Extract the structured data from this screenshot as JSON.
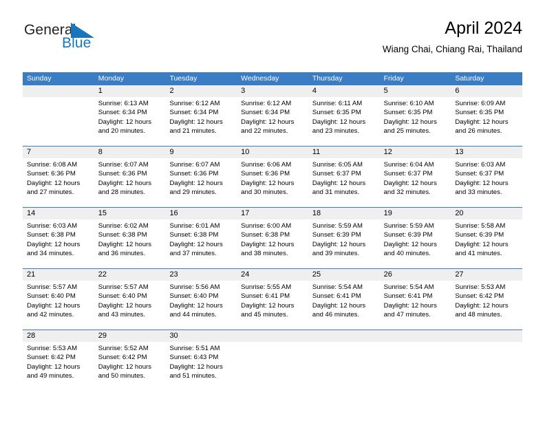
{
  "brand": {
    "name_part1": "General",
    "name_part2": "Blue",
    "flag_icon": "blue-triangle-flag-icon",
    "color_dark": "#231f20",
    "color_blue": "#1b75bc"
  },
  "header": {
    "title": "April 2024",
    "subtitle": "Wiang Chai, Chiang Rai, Thailand"
  },
  "theme": {
    "header_bg": "#3b7dc4",
    "header_text": "#ffffff",
    "daynum_bg": "#efefef",
    "rule_color": "#3b7dc4",
    "page_bg": "#ffffff"
  },
  "weekdays": [
    "Sunday",
    "Monday",
    "Tuesday",
    "Wednesday",
    "Thursday",
    "Friday",
    "Saturday"
  ],
  "weeks": [
    {
      "days": [
        {
          "num": "",
          "sunrise": "",
          "sunset": "",
          "daylight": "",
          "empty": true
        },
        {
          "num": "1",
          "sunrise": "Sunrise: 6:13 AM",
          "sunset": "Sunset: 6:34 PM",
          "daylight": "Daylight: 12 hours and 20 minutes."
        },
        {
          "num": "2",
          "sunrise": "Sunrise: 6:12 AM",
          "sunset": "Sunset: 6:34 PM",
          "daylight": "Daylight: 12 hours and 21 minutes."
        },
        {
          "num": "3",
          "sunrise": "Sunrise: 6:12 AM",
          "sunset": "Sunset: 6:34 PM",
          "daylight": "Daylight: 12 hours and 22 minutes."
        },
        {
          "num": "4",
          "sunrise": "Sunrise: 6:11 AM",
          "sunset": "Sunset: 6:35 PM",
          "daylight": "Daylight: 12 hours and 23 minutes."
        },
        {
          "num": "5",
          "sunrise": "Sunrise: 6:10 AM",
          "sunset": "Sunset: 6:35 PM",
          "daylight": "Daylight: 12 hours and 25 minutes."
        },
        {
          "num": "6",
          "sunrise": "Sunrise: 6:09 AM",
          "sunset": "Sunset: 6:35 PM",
          "daylight": "Daylight: 12 hours and 26 minutes."
        }
      ]
    },
    {
      "days": [
        {
          "num": "7",
          "sunrise": "Sunrise: 6:08 AM",
          "sunset": "Sunset: 6:36 PM",
          "daylight": "Daylight: 12 hours and 27 minutes."
        },
        {
          "num": "8",
          "sunrise": "Sunrise: 6:07 AM",
          "sunset": "Sunset: 6:36 PM",
          "daylight": "Daylight: 12 hours and 28 minutes."
        },
        {
          "num": "9",
          "sunrise": "Sunrise: 6:07 AM",
          "sunset": "Sunset: 6:36 PM",
          "daylight": "Daylight: 12 hours and 29 minutes."
        },
        {
          "num": "10",
          "sunrise": "Sunrise: 6:06 AM",
          "sunset": "Sunset: 6:36 PM",
          "daylight": "Daylight: 12 hours and 30 minutes."
        },
        {
          "num": "11",
          "sunrise": "Sunrise: 6:05 AM",
          "sunset": "Sunset: 6:37 PM",
          "daylight": "Daylight: 12 hours and 31 minutes."
        },
        {
          "num": "12",
          "sunrise": "Sunrise: 6:04 AM",
          "sunset": "Sunset: 6:37 PM",
          "daylight": "Daylight: 12 hours and 32 minutes."
        },
        {
          "num": "13",
          "sunrise": "Sunrise: 6:03 AM",
          "sunset": "Sunset: 6:37 PM",
          "daylight": "Daylight: 12 hours and 33 minutes."
        }
      ]
    },
    {
      "days": [
        {
          "num": "14",
          "sunrise": "Sunrise: 6:03 AM",
          "sunset": "Sunset: 6:38 PM",
          "daylight": "Daylight: 12 hours and 34 minutes."
        },
        {
          "num": "15",
          "sunrise": "Sunrise: 6:02 AM",
          "sunset": "Sunset: 6:38 PM",
          "daylight": "Daylight: 12 hours and 36 minutes."
        },
        {
          "num": "16",
          "sunrise": "Sunrise: 6:01 AM",
          "sunset": "Sunset: 6:38 PM",
          "daylight": "Daylight: 12 hours and 37 minutes."
        },
        {
          "num": "17",
          "sunrise": "Sunrise: 6:00 AM",
          "sunset": "Sunset: 6:38 PM",
          "daylight": "Daylight: 12 hours and 38 minutes."
        },
        {
          "num": "18",
          "sunrise": "Sunrise: 5:59 AM",
          "sunset": "Sunset: 6:39 PM",
          "daylight": "Daylight: 12 hours and 39 minutes."
        },
        {
          "num": "19",
          "sunrise": "Sunrise: 5:59 AM",
          "sunset": "Sunset: 6:39 PM",
          "daylight": "Daylight: 12 hours and 40 minutes."
        },
        {
          "num": "20",
          "sunrise": "Sunrise: 5:58 AM",
          "sunset": "Sunset: 6:39 PM",
          "daylight": "Daylight: 12 hours and 41 minutes."
        }
      ]
    },
    {
      "days": [
        {
          "num": "21",
          "sunrise": "Sunrise: 5:57 AM",
          "sunset": "Sunset: 6:40 PM",
          "daylight": "Daylight: 12 hours and 42 minutes."
        },
        {
          "num": "22",
          "sunrise": "Sunrise: 5:57 AM",
          "sunset": "Sunset: 6:40 PM",
          "daylight": "Daylight: 12 hours and 43 minutes."
        },
        {
          "num": "23",
          "sunrise": "Sunrise: 5:56 AM",
          "sunset": "Sunset: 6:40 PM",
          "daylight": "Daylight: 12 hours and 44 minutes."
        },
        {
          "num": "24",
          "sunrise": "Sunrise: 5:55 AM",
          "sunset": "Sunset: 6:41 PM",
          "daylight": "Daylight: 12 hours and 45 minutes."
        },
        {
          "num": "25",
          "sunrise": "Sunrise: 5:54 AM",
          "sunset": "Sunset: 6:41 PM",
          "daylight": "Daylight: 12 hours and 46 minutes."
        },
        {
          "num": "26",
          "sunrise": "Sunrise: 5:54 AM",
          "sunset": "Sunset: 6:41 PM",
          "daylight": "Daylight: 12 hours and 47 minutes."
        },
        {
          "num": "27",
          "sunrise": "Sunrise: 5:53 AM",
          "sunset": "Sunset: 6:42 PM",
          "daylight": "Daylight: 12 hours and 48 minutes."
        }
      ]
    },
    {
      "days": [
        {
          "num": "28",
          "sunrise": "Sunrise: 5:53 AM",
          "sunset": "Sunset: 6:42 PM",
          "daylight": "Daylight: 12 hours and 49 minutes."
        },
        {
          "num": "29",
          "sunrise": "Sunrise: 5:52 AM",
          "sunset": "Sunset: 6:42 PM",
          "daylight": "Daylight: 12 hours and 50 minutes."
        },
        {
          "num": "30",
          "sunrise": "Sunrise: 5:51 AM",
          "sunset": "Sunset: 6:43 PM",
          "daylight": "Daylight: 12 hours and 51 minutes."
        },
        {
          "num": "",
          "sunrise": "",
          "sunset": "",
          "daylight": "",
          "empty": true
        },
        {
          "num": "",
          "sunrise": "",
          "sunset": "",
          "daylight": "",
          "empty": true
        },
        {
          "num": "",
          "sunrise": "",
          "sunset": "",
          "daylight": "",
          "empty": true
        },
        {
          "num": "",
          "sunrise": "",
          "sunset": "",
          "daylight": "",
          "empty": true
        }
      ]
    }
  ]
}
